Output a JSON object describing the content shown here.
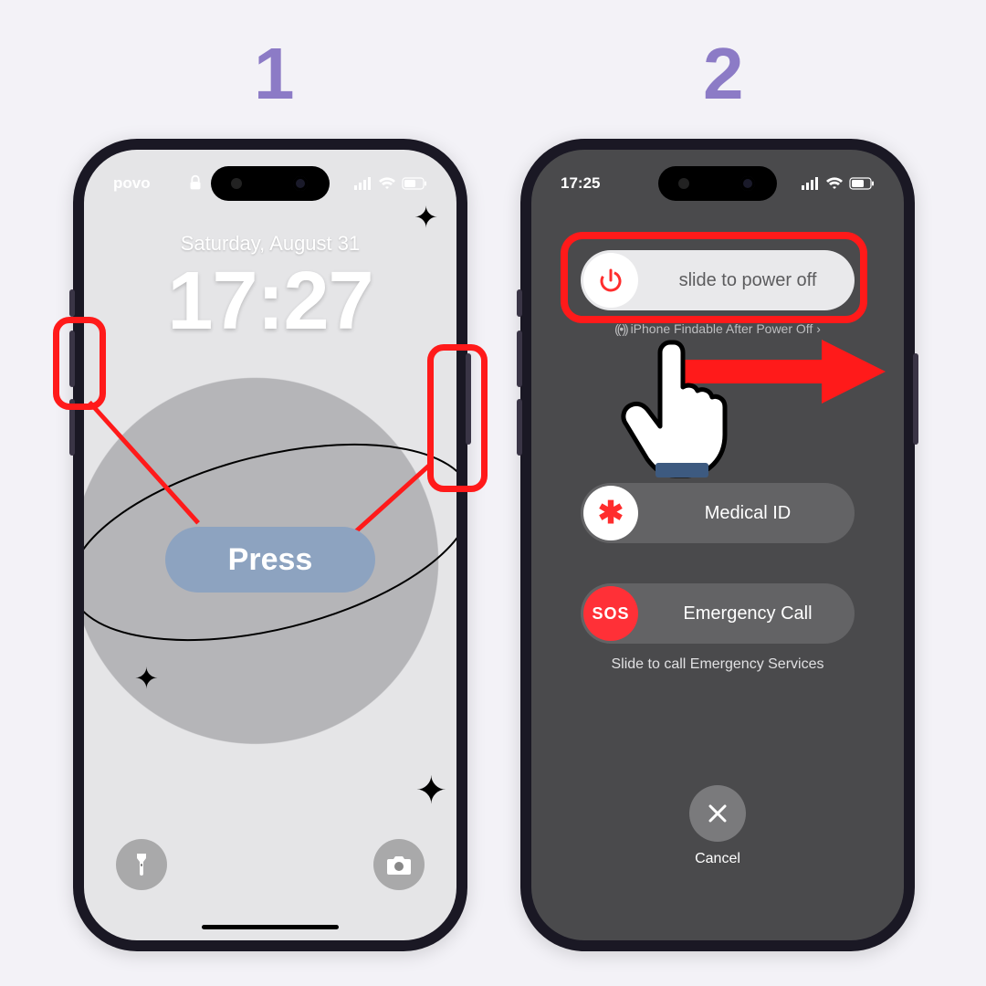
{
  "steps": {
    "one": "1",
    "two": "2"
  },
  "colors": {
    "accent": "#8c7bc6",
    "highlight": "#ff1a1a",
    "press_pill": "#8da3c0"
  },
  "phone1": {
    "carrier": "povo",
    "date": "Saturday, August 31",
    "time": "17:27",
    "press_label": "Press",
    "quick": {
      "left_icon": "flashlight",
      "right_icon": "camera"
    }
  },
  "phone2": {
    "time": "17:25",
    "power_slider": {
      "label": "slide to power off",
      "icon": "power"
    },
    "findable": "iPhone Findable After Power Off",
    "medical": {
      "label": "Medical ID",
      "icon": "asterisk"
    },
    "sos": {
      "label": "Emergency Call",
      "icon_text": "SOS"
    },
    "hint": "Slide to call Emergency Services",
    "cancel": "Cancel"
  }
}
